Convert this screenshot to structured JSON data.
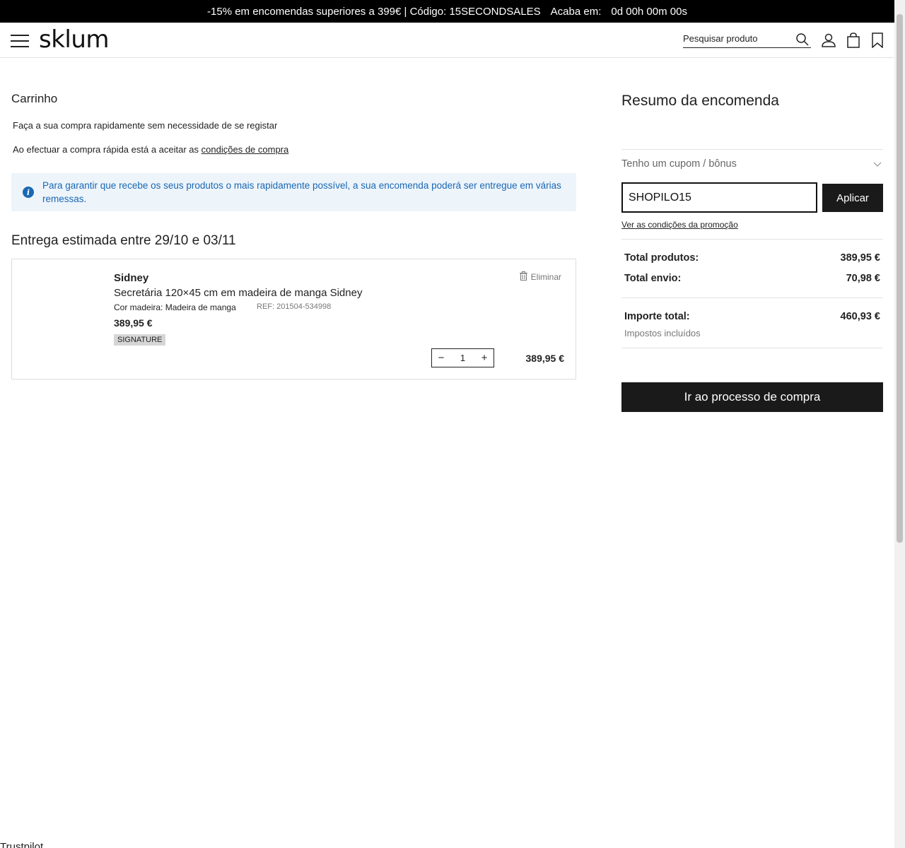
{
  "promo_bar": {
    "text": "-15% em encomendas superiores a 399€ | Código: 15SECONDSALES",
    "countdown_label": "Acaba em:",
    "countdown_value": "0d 00h 00m 00s"
  },
  "header": {
    "logo": "sklum",
    "search_placeholder": "Pesquisar produto",
    "icons": [
      "menu-icon",
      "search-icon",
      "user-icon",
      "bag-icon",
      "bookmark-icon"
    ]
  },
  "cart": {
    "title": "Carrinho",
    "quick_purchase_text": "Faça a sua compra rapidamente sem necessidade de se registar",
    "accept_prefix": "Ao efectuar a compra rápida está a aceitar as",
    "accept_link": "condições de compra",
    "info_message": "Para garantir que recebe os seus produtos o mais rapidamente possível, a sua encomenda poderá ser entregue em várias remessas.",
    "delivery_estimate": "Entrega estimada entre 29/10 e 03/11",
    "items": [
      {
        "brand": "Sidney",
        "name": "Secretária 120×45 cm em madeira de manga Sidney",
        "color": "Cor madeira: Madeira de manga",
        "ref": "REF: 201504-534998",
        "price": "389,95 €",
        "badge": "SIGNATURE",
        "delete_label": "Eliminar",
        "quantity": "1",
        "line_total": "389,95 €"
      }
    ]
  },
  "summary": {
    "title": "Resumo da encomenda",
    "coupon_label": "Tenho um cupom / bônus",
    "coupon_value": "SHOPILO15",
    "apply_label": "Aplicar",
    "promo_conditions_link": "Ver as condições da promoção",
    "total_products_label": "Total produtos:",
    "total_products_value": "389,95 €",
    "total_shipping_label": "Total envio:",
    "total_shipping_value": "70,98 €",
    "grand_total_label": "Importe total:",
    "grand_total_value": "460,93 €",
    "tax_note": "Impostos incluídos",
    "checkout_label": "Ir ao processo de compra"
  },
  "footer": {
    "trustpilot": "Trustpilot"
  },
  "colors": {
    "promo_bg": "#000000",
    "info_bg": "#edf4fa",
    "info_text": "#1a68b3",
    "button_bg": "#1a1a1a"
  }
}
